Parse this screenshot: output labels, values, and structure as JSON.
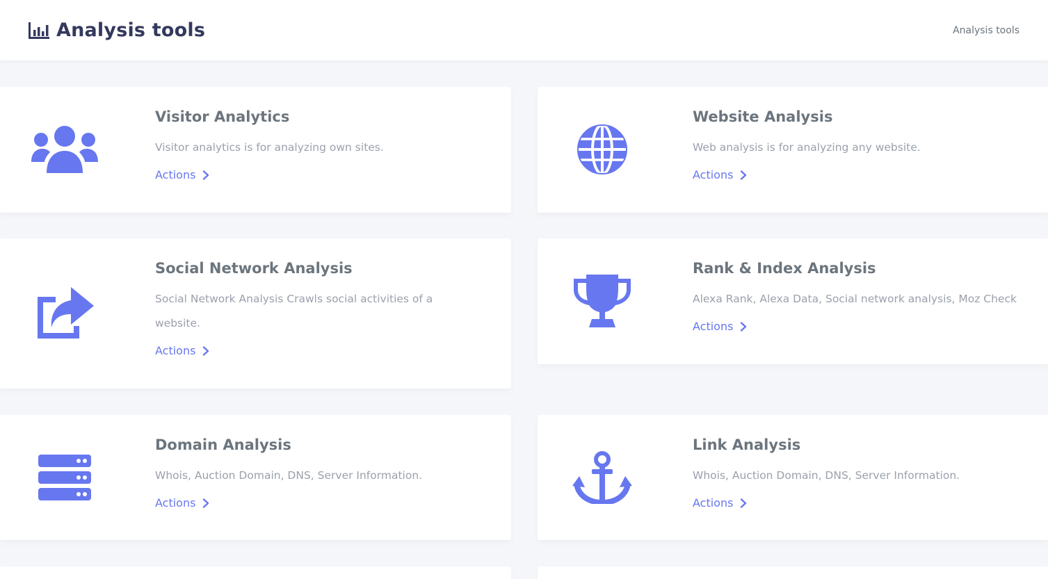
{
  "header": {
    "title": "Analysis tools",
    "title_icon": "chart-bar-icon",
    "breadcrumb": "Analysis tools"
  },
  "accent_color": "#6777ef",
  "cards": [
    {
      "title": "Visitor Analytics",
      "description": "Visitor analytics is for analyzing own sites.",
      "action": "Actions",
      "icon": "users-icon"
    },
    {
      "title": "Website Analysis",
      "description": "Web analysis is for analyzing any website.",
      "action": "Actions",
      "icon": "globe-icon"
    },
    {
      "title": "Social Network Analysis",
      "description": "Social Network Analysis Crawls social activities of a website.",
      "action": "Actions",
      "icon": "share-square-icon"
    },
    {
      "title": "Rank & Index Analysis",
      "description": "Alexa Rank, Alexa Data, Social network analysis, Moz Check",
      "action": "Actions",
      "icon": "trophy-icon"
    },
    {
      "title": "Domain Analysis",
      "description": "Whois, Auction Domain, DNS, Server Information.",
      "action": "Actions",
      "icon": "server-icon"
    },
    {
      "title": "Link Analysis",
      "description": "Whois, Auction Domain, DNS, Server Information.",
      "action": "Actions",
      "icon": "anchor-icon"
    }
  ]
}
